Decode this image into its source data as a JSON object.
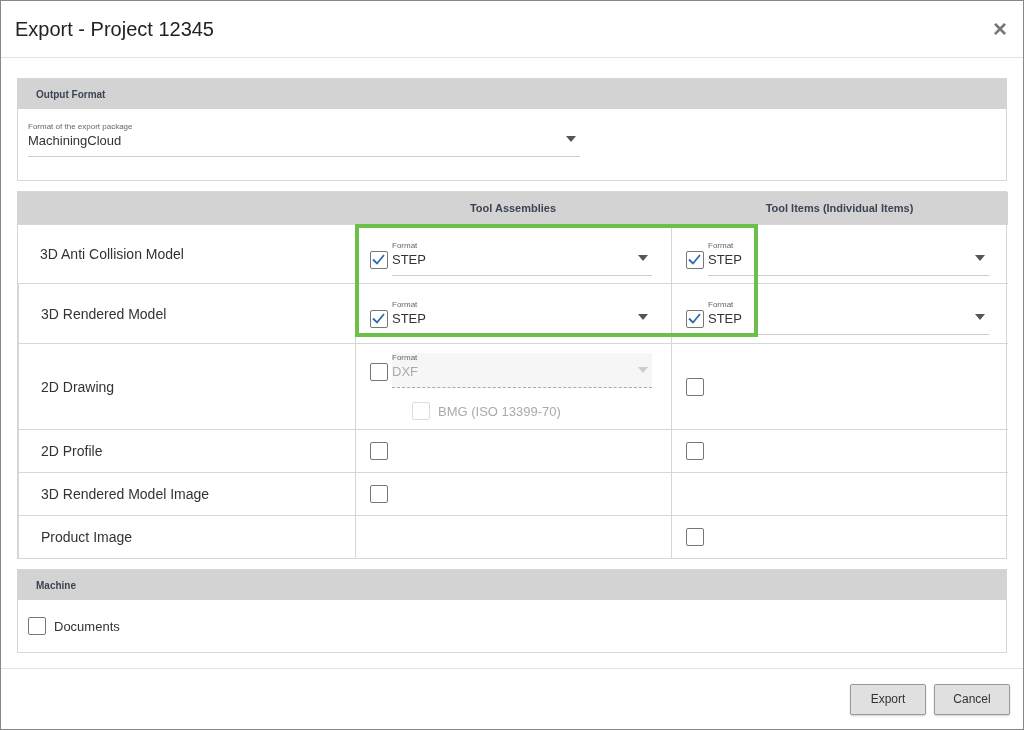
{
  "dialog": {
    "title": "Export - Project 12345",
    "close": "×"
  },
  "output_format": {
    "heading": "Output Format",
    "field": {
      "label": "Format of the export package",
      "value": "MachiningCloud"
    }
  },
  "table": {
    "highlight": true,
    "columns": [
      "Tool Assemblies",
      "Tool Items (Individual Items)"
    ],
    "rows": [
      {
        "name": "3D Anti Collision Model",
        "cells": [
          {
            "kind": "select",
            "checked": true,
            "label": "Format",
            "value": "STEP",
            "disabled": false
          },
          {
            "kind": "select",
            "checked": true,
            "label": "Format",
            "value": "STEP",
            "disabled": false
          }
        ]
      },
      {
        "name": "3D Rendered Model",
        "cells": [
          {
            "kind": "select",
            "checked": true,
            "label": "Format",
            "value": "STEP",
            "disabled": false
          },
          {
            "kind": "select",
            "checked": true,
            "label": "Format",
            "value": "STEP",
            "disabled": false
          }
        ]
      },
      {
        "name": "2D Drawing",
        "cells": [
          {
            "kind": "select",
            "checked": false,
            "label": "Format",
            "value": "DXF",
            "disabled": true,
            "option": {
              "label": "BMG (ISO 13399-70)",
              "checked": false,
              "disabled": true
            }
          },
          {
            "kind": "checkbox",
            "checked": false
          }
        ]
      },
      {
        "name": "2D Profile",
        "cells": [
          {
            "kind": "checkbox",
            "checked": false
          },
          {
            "kind": "checkbox",
            "checked": false
          }
        ]
      },
      {
        "name": "3D Rendered Model Image",
        "cells": [
          {
            "kind": "checkbox",
            "checked": false
          },
          {
            "kind": "empty"
          }
        ]
      },
      {
        "name": "Product Image",
        "cells": [
          {
            "kind": "empty"
          },
          {
            "kind": "checkbox",
            "checked": false
          }
        ]
      }
    ]
  },
  "machine": {
    "heading": "Machine",
    "items": [
      {
        "label": "Documents",
        "checked": false
      }
    ]
  },
  "buttons": [
    {
      "label": "Export"
    },
    {
      "label": "Cancel"
    }
  ]
}
